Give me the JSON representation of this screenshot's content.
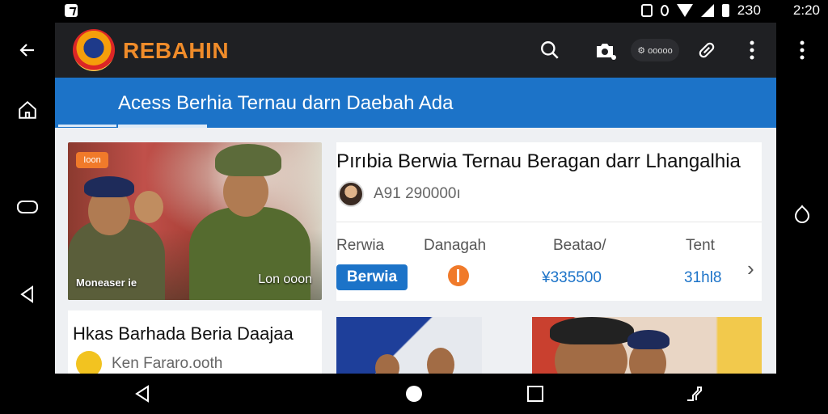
{
  "status_bar": {
    "time": "2З0",
    "time_right": "2:20"
  },
  "app": {
    "brand": "REBAHIN"
  },
  "toolbar": {
    "pill_text": "⚙ ооооо"
  },
  "tabs": {
    "active_label": "Acess Berhia Ternau darn Daebah Ada"
  },
  "featured": {
    "badge": "Ioon",
    "caption_left": "Moneaser ie",
    "caption_right": "Lon ooon"
  },
  "article": {
    "title": "Pırıbia Berwia Ternau Beragan darr Lhangalhia",
    "meta": "A91 290000ı"
  },
  "stats": {
    "headers": [
      "Rerwia",
      "Danagah",
      "Beatao/",
      "Tent"
    ],
    "button_label": "Berwia",
    "values": [
      "¥335500",
      "31hl8"
    ]
  },
  "card2": {
    "title": "Hkas Barhada Beria Daajaa",
    "meta": "Ken Fararo.ooth"
  },
  "colors": {
    "accent": "#1c73c8",
    "brand": "#f08c2a",
    "badge": "#f07a2a"
  }
}
